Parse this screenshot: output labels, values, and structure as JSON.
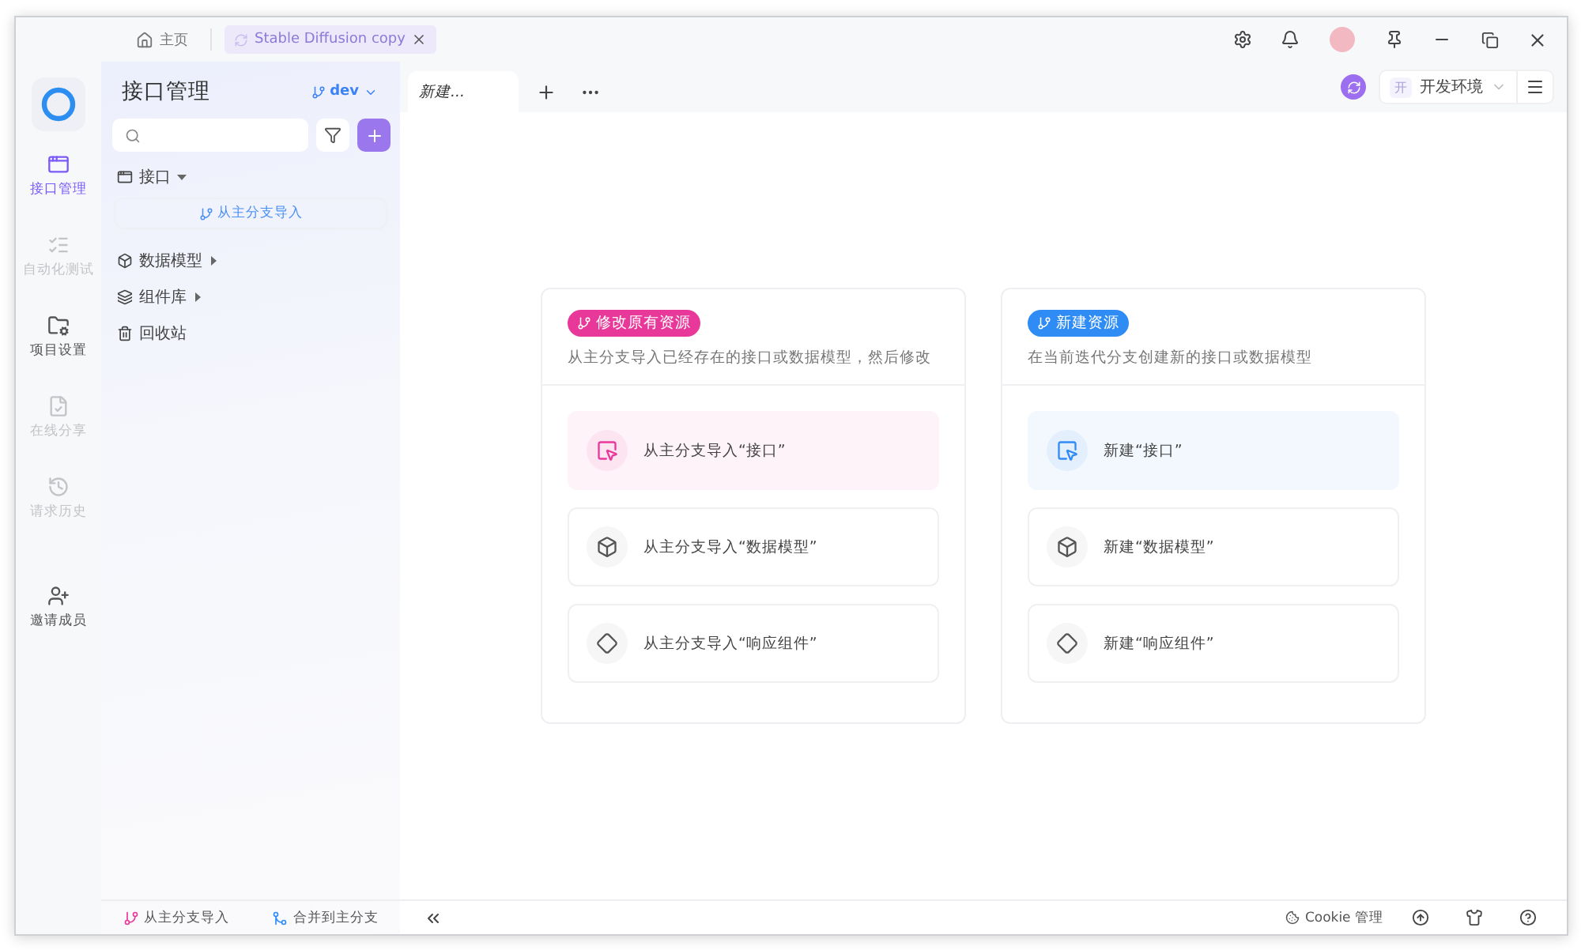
{
  "title_bar": {
    "tabs": [
      {
        "label": "主页",
        "kind": "home",
        "selected": false
      },
      {
        "label": "Stable Diffusion copy",
        "kind": "project",
        "selected": true
      }
    ]
  },
  "nav_rail": {
    "items": [
      {
        "label": "接口管理",
        "selected": true,
        "disabled": false
      },
      {
        "label": "自动化测试",
        "selected": false,
        "disabled": true
      },
      {
        "label": "项目设置",
        "selected": false,
        "disabled": false
      },
      {
        "label": "在线分享",
        "selected": false,
        "disabled": true
      },
      {
        "label": "请求历史",
        "selected": false,
        "disabled": true
      },
      {
        "label": "邀请成员",
        "selected": false,
        "disabled": false
      }
    ]
  },
  "sidebar": {
    "title": "接口管理",
    "branch": "dev",
    "tree": [
      {
        "label": "接口",
        "expanded": true,
        "children": [
          {
            "label": "从主分支导入"
          }
        ]
      },
      {
        "label": "数据模型",
        "expanded": false
      },
      {
        "label": "组件库",
        "expanded": false
      },
      {
        "label": "回收站"
      }
    ],
    "footer": [
      "从主分支导入",
      "合并到主分支"
    ]
  },
  "editor_tabs": [
    {
      "label": "新建...",
      "selected": true
    }
  ],
  "environment": {
    "badge": "开",
    "label": "开发环境"
  },
  "cards": [
    {
      "badge": "修改原有资源",
      "color": "#e8399a",
      "description": "从主分支导入已经存在的接口或数据模型，然后修改",
      "items": [
        {
          "label": "从主分支导入“接口”",
          "highlighted": true
        },
        {
          "label": "从主分支导入“数据模型”",
          "highlighted": false
        },
        {
          "label": "从主分支导入“响应组件”",
          "highlighted": false
        }
      ]
    },
    {
      "badge": "新建资源",
      "color": "#2f8cf5",
      "description": "在当前迭代分支创建新的接口或数据模型",
      "items": [
        {
          "label": "新建“接口”",
          "highlighted": true
        },
        {
          "label": "新建“数据模型”",
          "highlighted": false
        },
        {
          "label": "新建“响应组件”",
          "highlighted": false
        }
      ]
    }
  ],
  "status_bar": {
    "cookie": "Cookie 管理"
  }
}
